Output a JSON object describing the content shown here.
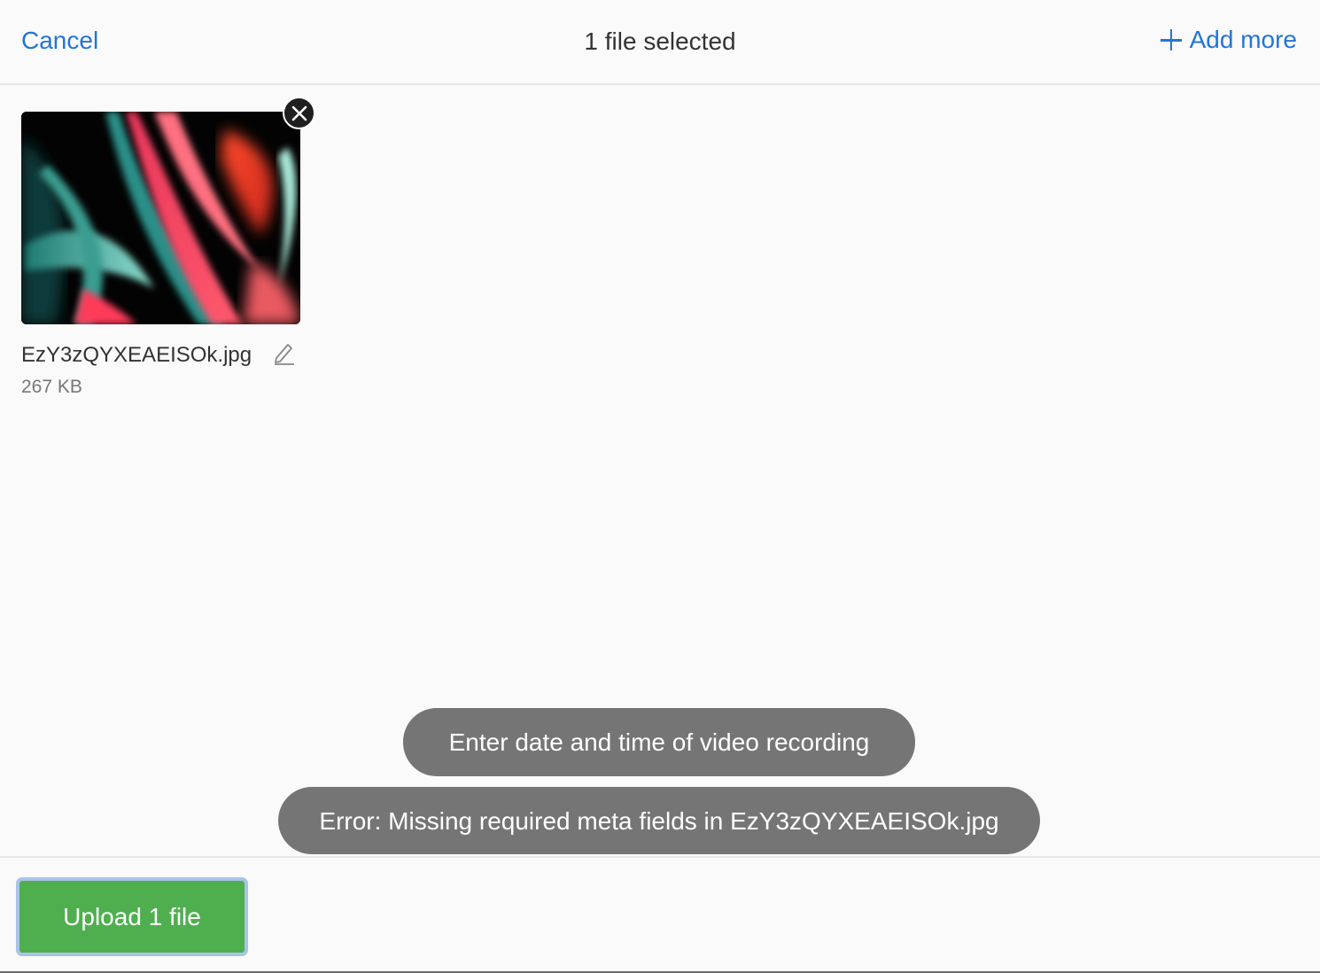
{
  "header": {
    "cancel_label": "Cancel",
    "title": "1 file selected",
    "add_more_label": "Add more",
    "add_more_icon": "plus-icon"
  },
  "files": [
    {
      "name": "EzY3zQYXEAEISOk.jpg",
      "size": "267 KB",
      "remove_icon": "close-icon",
      "edit_icon": "pencil-icon"
    }
  ],
  "notifications": [
    "Enter date and time of video recording",
    "Error: Missing required meta fields in EzY3zQYXEAEISOk.jpg"
  ],
  "footer": {
    "upload_label": "Upload 1 file"
  },
  "colors": {
    "accent": "#2275d7",
    "upload_button": "#4faf4f",
    "toast_background": "#757575"
  }
}
